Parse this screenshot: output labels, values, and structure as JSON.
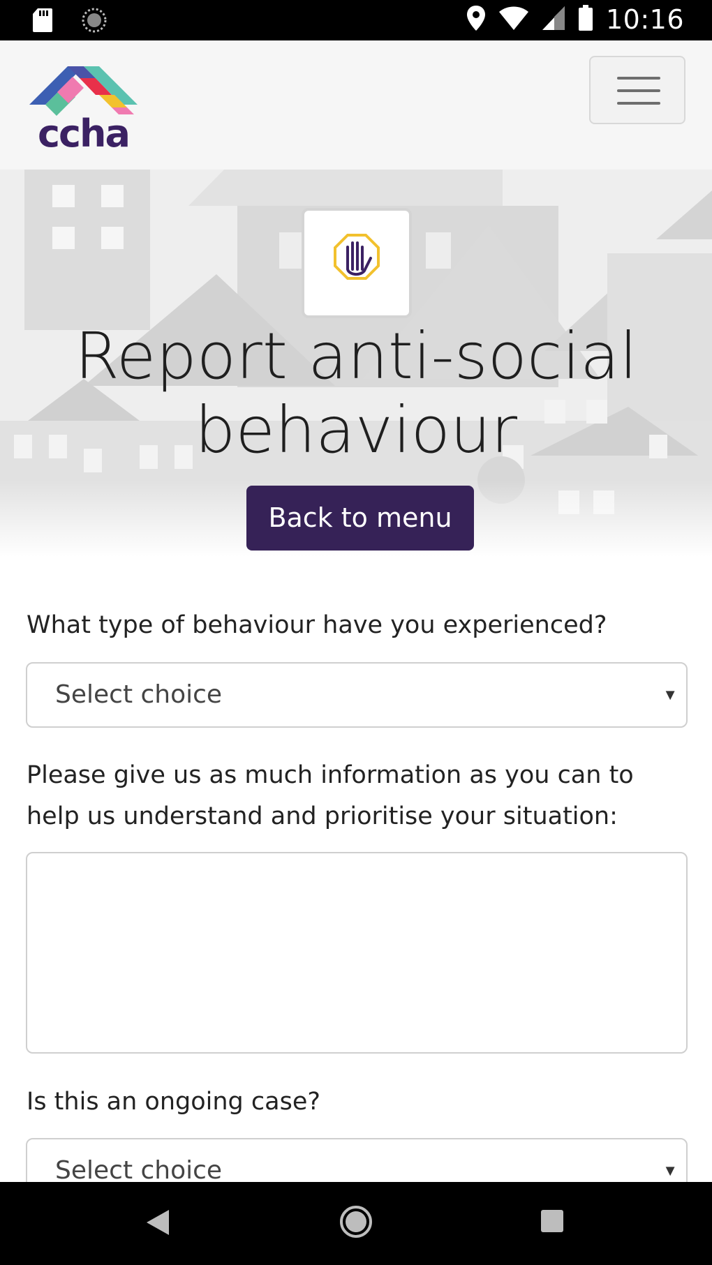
{
  "status_bar": {
    "time": "10:16",
    "icons": [
      "sd-card-icon",
      "sync-icon",
      "location-icon",
      "wifi-icon",
      "signal-icon",
      "battery-icon"
    ]
  },
  "header": {
    "logo_text": "ccha",
    "menu_icon": "hamburger-icon"
  },
  "hero": {
    "icon": "stop-hand-icon",
    "title": "Report anti-social behaviour",
    "back_button": "Back to menu"
  },
  "form": {
    "q1_label": "What type of behaviour have you experienced?",
    "q1_value": "Select choice",
    "q2_label_line1": "Please give us as much information as you can to",
    "q2_label_line2": "help us understand and prioritise your situation:",
    "q2_value": "",
    "q3_label": "Is this an ongoing case?",
    "q3_value": "Select choice"
  },
  "nav": {
    "back": "back-icon",
    "home": "home-icon",
    "recents": "recents-icon"
  },
  "colors": {
    "brand_purple": "#362257",
    "logo_text": "#3b2163",
    "icon_yellow": "#f2c12e"
  }
}
